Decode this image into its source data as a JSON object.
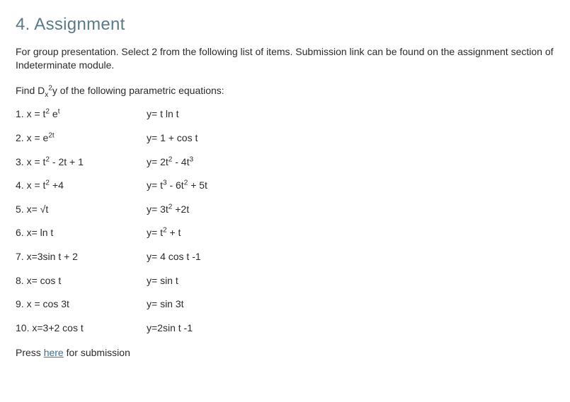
{
  "title": "4. Assignment",
  "intro": "For group presentation. Select 2 from the following list of items. Submission link can be found on the assignment section of Indeterminate module.",
  "instruction_prefix": "Find D",
  "instruction_sub": "x",
  "instruction_sup": "2",
  "instruction_mid": "y of the following parametric equations:",
  "items": [
    {
      "num": "1.",
      "x_pre": " x = t",
      "x_sup1": "2",
      "x_mid": " e",
      "x_sup2": "t",
      "x_post": "",
      "y": "y= t ln t"
    },
    {
      "num": "2.",
      "x_pre": " x =  e",
      "x_sup1": "2t",
      "x_mid": "",
      "x_sup2": "",
      "x_post": "",
      "y": "y= 1 + cos t"
    },
    {
      "num": "3.",
      "x_pre": " x = t",
      "x_sup1": "2",
      "x_mid": " - 2t + 1",
      "x_sup2": "",
      "x_post": "",
      "y_pre": "y= 2t",
      "y_sup1": "2",
      "y_mid": " - 4t",
      "y_sup2": "3",
      "y_post": ""
    },
    {
      "num": "4.",
      "x_pre": " x = t",
      "x_sup1": "2",
      "x_mid": " +4",
      "x_sup2": "",
      "x_post": "",
      "y_pre": "y= t",
      "y_sup1": "3",
      "y_mid": " - 6t",
      "y_sup2": "2",
      "y_post": " + 5t"
    },
    {
      "num": "5.",
      "x_pre": " x= √t",
      "x_sup1": "",
      "x_mid": "",
      "x_sup2": "",
      "x_post": "",
      "y_pre": "y= 3t",
      "y_sup1": "2",
      "y_mid": "  +2t",
      "y_sup2": "",
      "y_post": ""
    },
    {
      "num": "6.",
      "x_pre": " x= ln t",
      "x_sup1": "",
      "x_mid": "",
      "x_sup2": "",
      "x_post": "",
      "y_pre": "y= t",
      "y_sup1": "2",
      "y_mid": "  + t",
      "y_sup2": "",
      "y_post": ""
    },
    {
      "num": "7.",
      "x_pre": " x=3sin t + 2",
      "x_sup1": "",
      "x_mid": "",
      "x_sup2": "",
      "x_post": "",
      "y": " y= 4 cos t -1"
    },
    {
      "num": "8.",
      "x_pre": " x= cos t",
      "x_sup1": "",
      "x_mid": "",
      "x_sup2": "",
      "x_post": "",
      "y": "y= sin t"
    },
    {
      "num": "9.",
      "x_pre": " x = cos 3t",
      "x_sup1": "",
      "x_mid": "",
      "x_sup2": "",
      "x_post": "",
      "y": "y= sin 3t"
    },
    {
      "num": "10.",
      "x_pre": " x=3+2 cos t",
      "x_sup1": "",
      "x_mid": "",
      "x_sup2": "",
      "x_post": "",
      "y": "y=2sin t -1"
    }
  ],
  "press_prefix": "Press ",
  "press_link": "here",
  "press_suffix": " for submission"
}
